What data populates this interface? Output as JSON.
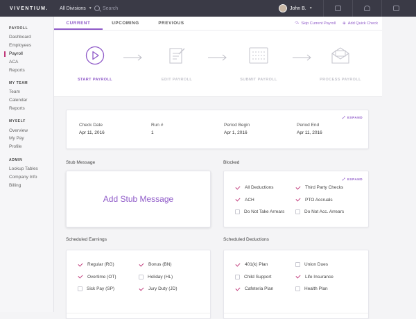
{
  "topbar": {
    "logo": "VIVENTIUM.",
    "division": "All Divisions",
    "search_placeholder": "Search",
    "user_name": "John B."
  },
  "sidebar": {
    "groups": [
      {
        "heading": "PAYROLL",
        "items": [
          "Dashboard",
          "Employees",
          "Payroll",
          "ACA",
          "Reports"
        ]
      },
      {
        "heading": "MY TEAM",
        "items": [
          "Team",
          "Calendar",
          "Reports"
        ]
      },
      {
        "heading": "MYSELF",
        "items": [
          "Overview",
          "My Pay",
          "Profile"
        ]
      },
      {
        "heading": "ADMIN",
        "items": [
          "Lookup Tables",
          "Company Info",
          "Billing"
        ]
      }
    ],
    "active_item": "Payroll"
  },
  "tabs": {
    "current": "CURRENT",
    "upcoming": "UPCOMING",
    "previous": "PREVIOUS",
    "skip": "Skip Current Payroll",
    "add_quick": "Add Quick Check"
  },
  "steps": [
    "START PAYROLL",
    "EDIT PAYROLL",
    "SUBMIT PAYROLL",
    "PROCESS PAYROLL"
  ],
  "stats": {
    "expand": "EXPAND",
    "check_date_label": "Check Date",
    "check_date": "Apr 11, 2016",
    "run_label": "Run #",
    "run": "1",
    "period_begin_label": "Period Begin",
    "period_begin": "Apr 1, 2016",
    "period_end_label": "Period End",
    "period_end": "Apr 11, 2016"
  },
  "stub": {
    "title": "Stub Message",
    "placeholder": "Add Stub Message"
  },
  "blocked": {
    "title": "Blocked",
    "expand": "EXPAND",
    "items": [
      {
        "label": "All Deductions",
        "checked": true
      },
      {
        "label": "Third Party Checks",
        "checked": true
      },
      {
        "label": "ACH",
        "checked": true
      },
      {
        "label": "PTO Accruals",
        "checked": true
      },
      {
        "label": "Do Not Take Arrears",
        "checked": false
      },
      {
        "label": "Do Not Acc. Arrears",
        "checked": false
      }
    ]
  },
  "earnings": {
    "title": "Scheduled Earnings",
    "items": [
      {
        "label": "Regular (RG)",
        "checked": true
      },
      {
        "label": "Bonus (BN)",
        "checked": true
      },
      {
        "label": "Overtime (OT)",
        "checked": true
      },
      {
        "label": "Holiday (HL)",
        "checked": false
      },
      {
        "label": "Sick Pay (SP)",
        "checked": false
      },
      {
        "label": "Jury Duty (JD)",
        "checked": true
      }
    ]
  },
  "deductions": {
    "title": "Scheduled Deductions",
    "items": [
      {
        "label": "401(k) Plan",
        "checked": true
      },
      {
        "label": "Union Dues",
        "checked": false
      },
      {
        "label": "Child Support",
        "checked": false
      },
      {
        "label": "Life Insurance",
        "checked": true
      },
      {
        "label": "Cafeteria Plan",
        "checked": true
      },
      {
        "label": "Health Plan",
        "checked": false
      }
    ]
  },
  "colors": {
    "accent": "#8f5ac8",
    "check": "#c0397a",
    "topbar": "#3a3a46"
  }
}
